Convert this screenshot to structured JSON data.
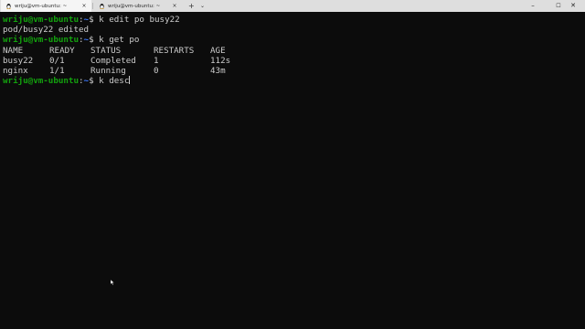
{
  "tabs": [
    {
      "label": "wriju@vm-ubuntu: ~",
      "close": "×",
      "active": true
    },
    {
      "label": "wriju@vm-ubuntu: ~",
      "close": "×",
      "active": false
    }
  ],
  "tab_controls": {
    "new_tab": "+",
    "dropdown": "⌄"
  },
  "window_controls": {
    "minimize": "–",
    "maximize": "☐",
    "close": "✕"
  },
  "terminal": {
    "prompt": {
      "user_host": "wriju@vm-ubuntu",
      "separator": ":",
      "path": "~",
      "symbol": "$"
    },
    "cmd1": "k edit po busy22",
    "out1": "pod/busy22 edited",
    "cmd2": "k get po",
    "table": {
      "headers": [
        "NAME",
        "READY",
        "STATUS",
        "RESTARTS",
        "AGE"
      ],
      "rows": [
        [
          "busy22",
          "0/1",
          "Completed",
          "1",
          "112s"
        ],
        [
          "nginx",
          "1/1",
          "Running",
          "0",
          "43m"
        ]
      ]
    },
    "cmd3": "k desc"
  },
  "colors": {
    "background": "#0c0c0c",
    "prompt_user": "#13a10e",
    "prompt_path": "#3b78ff",
    "text": "#cccccc"
  }
}
